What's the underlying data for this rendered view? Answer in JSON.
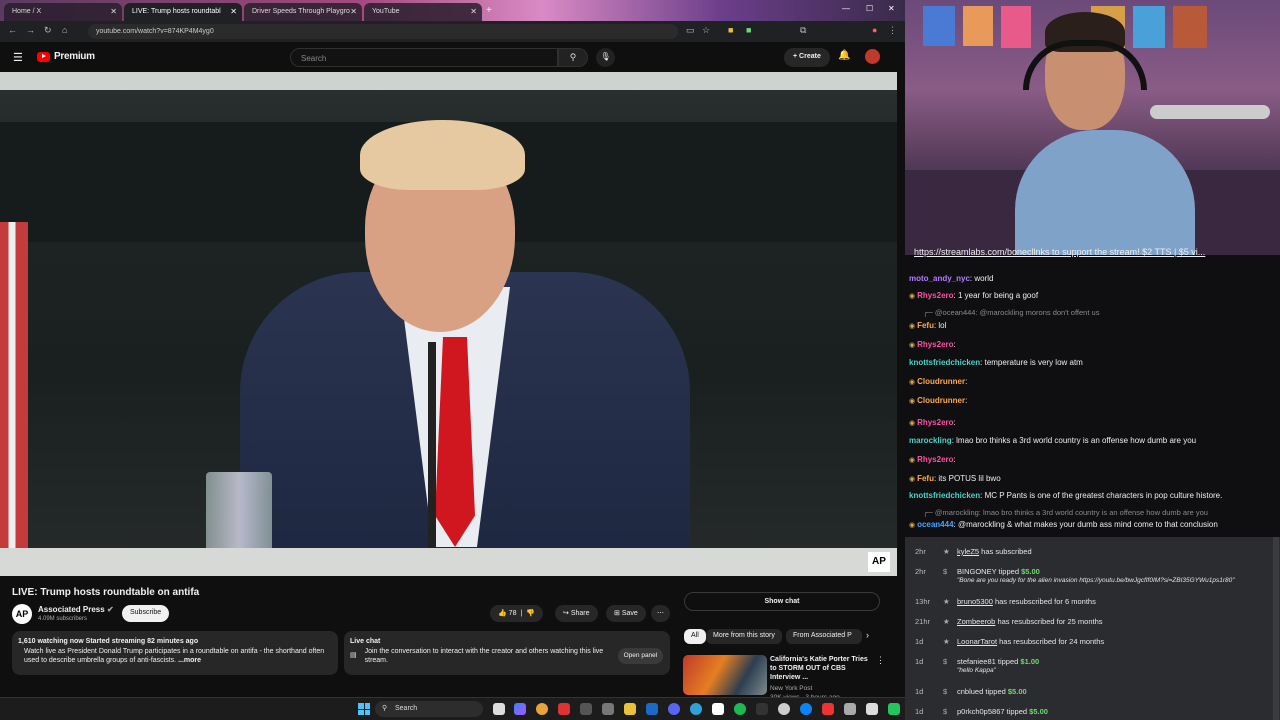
{
  "browser": {
    "tabs": [
      {
        "label": "Home / X"
      },
      {
        "label": "LIVE: Trump hosts roundtabl"
      },
      {
        "label": "Driver Speeds Through Playgro"
      },
      {
        "label": "YouTube"
      }
    ],
    "url": "youtube.com/watch?v=874KP4M4yg0"
  },
  "youtube": {
    "logo_text": "Premium",
    "search_placeholder": "Search",
    "create_label": "Create",
    "video_title": "LIVE: Trump hosts roundtable on antifa",
    "channel_name": "Associated Press",
    "channel_subs": "4.09M subscribers",
    "channel_avatar": "AP",
    "subscribe_label": "Subscribe",
    "like_count": "78",
    "share_label": "Share",
    "save_label": "Save",
    "watermark": "AP",
    "description": {
      "stats": "1,610 watching now  Started streaming 82 minutes ago",
      "text": "Watch live as President Donald Trump participates in a roundtable on antifa - the shorthand often used to describe umbrella groups of anti-fascists.",
      "more": "...more"
    },
    "live_chat": {
      "title": "Live chat",
      "text": "Join the conversation to interact with the creator and others watching this live stream.",
      "button": "Open panel"
    },
    "show_chat_label": "Show chat",
    "chips": [
      "All",
      "More from this story",
      "From Associated P"
    ],
    "recommendation": {
      "title": "California's Katie Porter Tries to STORM OUT of CBS Interview ...",
      "channel": "New York Post",
      "meta": "30K views · 3 hours ago"
    }
  },
  "taskbar": {
    "search_label": "Search"
  },
  "stream_chat": {
    "banner": "https://streamlabs.com/bonecllnks  to support the stream! $2 TTS | $5 vi...",
    "messages": [
      {
        "user": "moto_andy_nyc",
        "color": "#b57bff",
        "text": "world",
        "badge": false
      },
      {
        "user": "Rhys2ero",
        "color": "#ff4fa3",
        "text": "1 year for being a goof",
        "badge": true
      },
      {
        "reply": "@ocean444: @marockling morons don't offent us"
      },
      {
        "user": "Fefu",
        "color": "#ffa64d",
        "text": "lol",
        "badge": true
      },
      {
        "user": "Rhys2ero",
        "color": "#ff4fa3",
        "text": "",
        "badge": true
      },
      {
        "user": "knottsfriedchicken",
        "color": "#4fd1c5",
        "text": "temperature is very low atm",
        "badge": false
      },
      {
        "user": "Cloudrunner",
        "color": "#ffa64d",
        "text": "",
        "badge": true
      },
      {
        "user": "Cloudrunner",
        "color": "#ffa64d",
        "text": "",
        "badge": true
      },
      {
        "user": "Rhys2ero",
        "color": "#ff4fa3",
        "text": "",
        "badge": true
      },
      {
        "user": "marockling",
        "color": "#4fd1c5",
        "text": "lmao bro thinks a 3rd world country is an offense how dumb are you",
        "badge": false
      },
      {
        "user": "Rhys2ero",
        "color": "#ff4fa3",
        "text": "",
        "badge": true
      },
      {
        "user": "Fefu",
        "color": "#ffa64d",
        "text": "its POTUS lil bwo",
        "badge": true
      },
      {
        "user": "knottsfriedchicken",
        "color": "#4fd1c5",
        "text": "MC P Pants is one of the greatest characters in pop culture histore.",
        "badge": false
      },
      {
        "reply": "@marockling: lmao bro thinks a 3rd world country is an offense how dumb are you"
      },
      {
        "user": "ocean444",
        "color": "#3ea6ff",
        "text": "@marockling & what makes your dumb ass mind come to that conclusion",
        "badge": true
      }
    ]
  },
  "events": [
    {
      "time": "2hr",
      "user": "kyleZ5",
      "action": "has subscribed",
      "sub": ""
    },
    {
      "time": "2hr",
      "user": "BINGONEY",
      "action": "tipped",
      "amount": "$5.00",
      "sub": "\"Bone are you ready for the alien invasion https://youtu.be/bwJgcfIf0IM?si=ZBI35GYWu1ps1r80\""
    },
    {
      "time": "13hr",
      "user": "bruno5300",
      "action": "has resubscribed for 6 months",
      "sub": ""
    },
    {
      "time": "21hr",
      "user": "Zombeerob",
      "action": "has resubscribed for 25 months",
      "sub": ""
    },
    {
      "time": "1d",
      "user": "LoonarTarot",
      "action": "has resubscribed for 24 months",
      "sub": ""
    },
    {
      "time": "1d",
      "user": "stefaniee81",
      "action": "tipped",
      "amount": "$1.00",
      "sub": "\"hello Kappa\""
    },
    {
      "time": "1d",
      "user": "cnblued",
      "action": "tipped",
      "amount": "$5.00",
      "sub": ""
    },
    {
      "time": "1d",
      "user": "p0rkch0p5867",
      "action": "tipped",
      "amount": "$5.00",
      "sub": ""
    }
  ]
}
